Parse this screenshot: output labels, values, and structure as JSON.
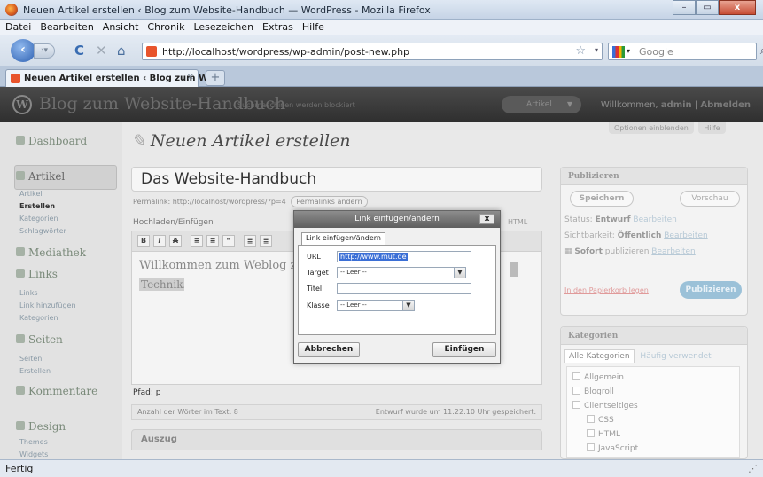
{
  "window": {
    "title": "Neuen Artikel erstellen ‹ Blog zum Website-Handbuch — WordPress - Mozilla Firefox",
    "min": "–",
    "max": "▭",
    "close": "x"
  },
  "menu": [
    "Datei",
    "Bearbeiten",
    "Ansicht",
    "Chronik",
    "Lesezeichen",
    "Extras",
    "Hilfe"
  ],
  "nav": {
    "url": "http://localhost/wordpress/wp-admin/post-new.php",
    "search_placeholder": "Google"
  },
  "tab": {
    "label": "Neuen Artikel erstellen ‹ Blog zum W...",
    "new_tab": "+"
  },
  "wp": {
    "blog_name": "Blog zum Website-Handbuch",
    "blocked_note": "Suchmaschinen werden blockiert",
    "fav_label": "Artikel",
    "welcome": "Willkommen,",
    "user": "admin",
    "logout": "Abmelden",
    "screen_options": "Optionen einblenden",
    "help": "Hilfe"
  },
  "sidebar": {
    "dashboard": "Dashboard",
    "artikel": "Artikel",
    "artikel_sub": [
      "Artikel",
      "Erstellen",
      "Kategorien",
      "Schlagwörter"
    ],
    "mediathek": "Mediathek",
    "links": "Links",
    "links_sub": [
      "Links",
      "Link hinzufügen",
      "Kategorien"
    ],
    "seiten": "Seiten",
    "seiten_sub": [
      "Seiten",
      "Erstellen"
    ],
    "kommentare": "Kommentare",
    "design": "Design",
    "design_sub": [
      "Themes",
      "Widgets"
    ]
  },
  "editor": {
    "page_title": "Neuen Artikel erstellen",
    "post_title": "Das Website-Handbuch",
    "permalink_label": "Permalink:",
    "permalink_url": "http://localhost/wordpress/?p=4",
    "permalink_btn": "Permalinks ändern",
    "upload_label": "Hochladen/Einfügen",
    "html_tab": "HTML",
    "content_line": "Willkommen zum Weblog zu",
    "content_selected": "Technik",
    "content_end": ".",
    "path": "Pfad: p",
    "word_count": "Anzahl der Wörter im Text: 8",
    "saved_note": "Entwurf wurde um 11:22:10 Uhr gespeichert.",
    "excerpt": "Auszug"
  },
  "publish": {
    "heading": "Publizieren",
    "save": "Speichern",
    "preview": "Vorschau",
    "status_label": "Status:",
    "status_value": "Entwurf",
    "visibility_label": "Sichtbarkeit:",
    "visibility_value": "Öffentlich",
    "edit": "Bearbeiten",
    "publish_now": "Sofort",
    "publish_now_rest": "publizieren",
    "trash": "In den Papierkorb legen",
    "publish_btn": "Publizieren"
  },
  "categories": {
    "heading": "Kategorien",
    "tab_all": "Alle Kategorien",
    "tab_used": "Häufig verwendet",
    "items": [
      "Allgemein",
      "Blogroll",
      "Clientseitiges",
      "CSS",
      "HTML",
      "JavaScript"
    ]
  },
  "dialog": {
    "title": "Link einfügen/ändern",
    "close": "x",
    "tab": "Link einfügen/ändern",
    "url_label": "URL",
    "url_value": "http://www.mut.de",
    "target_label": "Target",
    "target_value": "-- Leer --",
    "title_label": "Titel",
    "title_value": "",
    "class_label": "Klasse",
    "class_value": "-- Leer --",
    "cancel": "Abbrechen",
    "insert": "Einfügen"
  },
  "status": {
    "text": "Fertig"
  }
}
